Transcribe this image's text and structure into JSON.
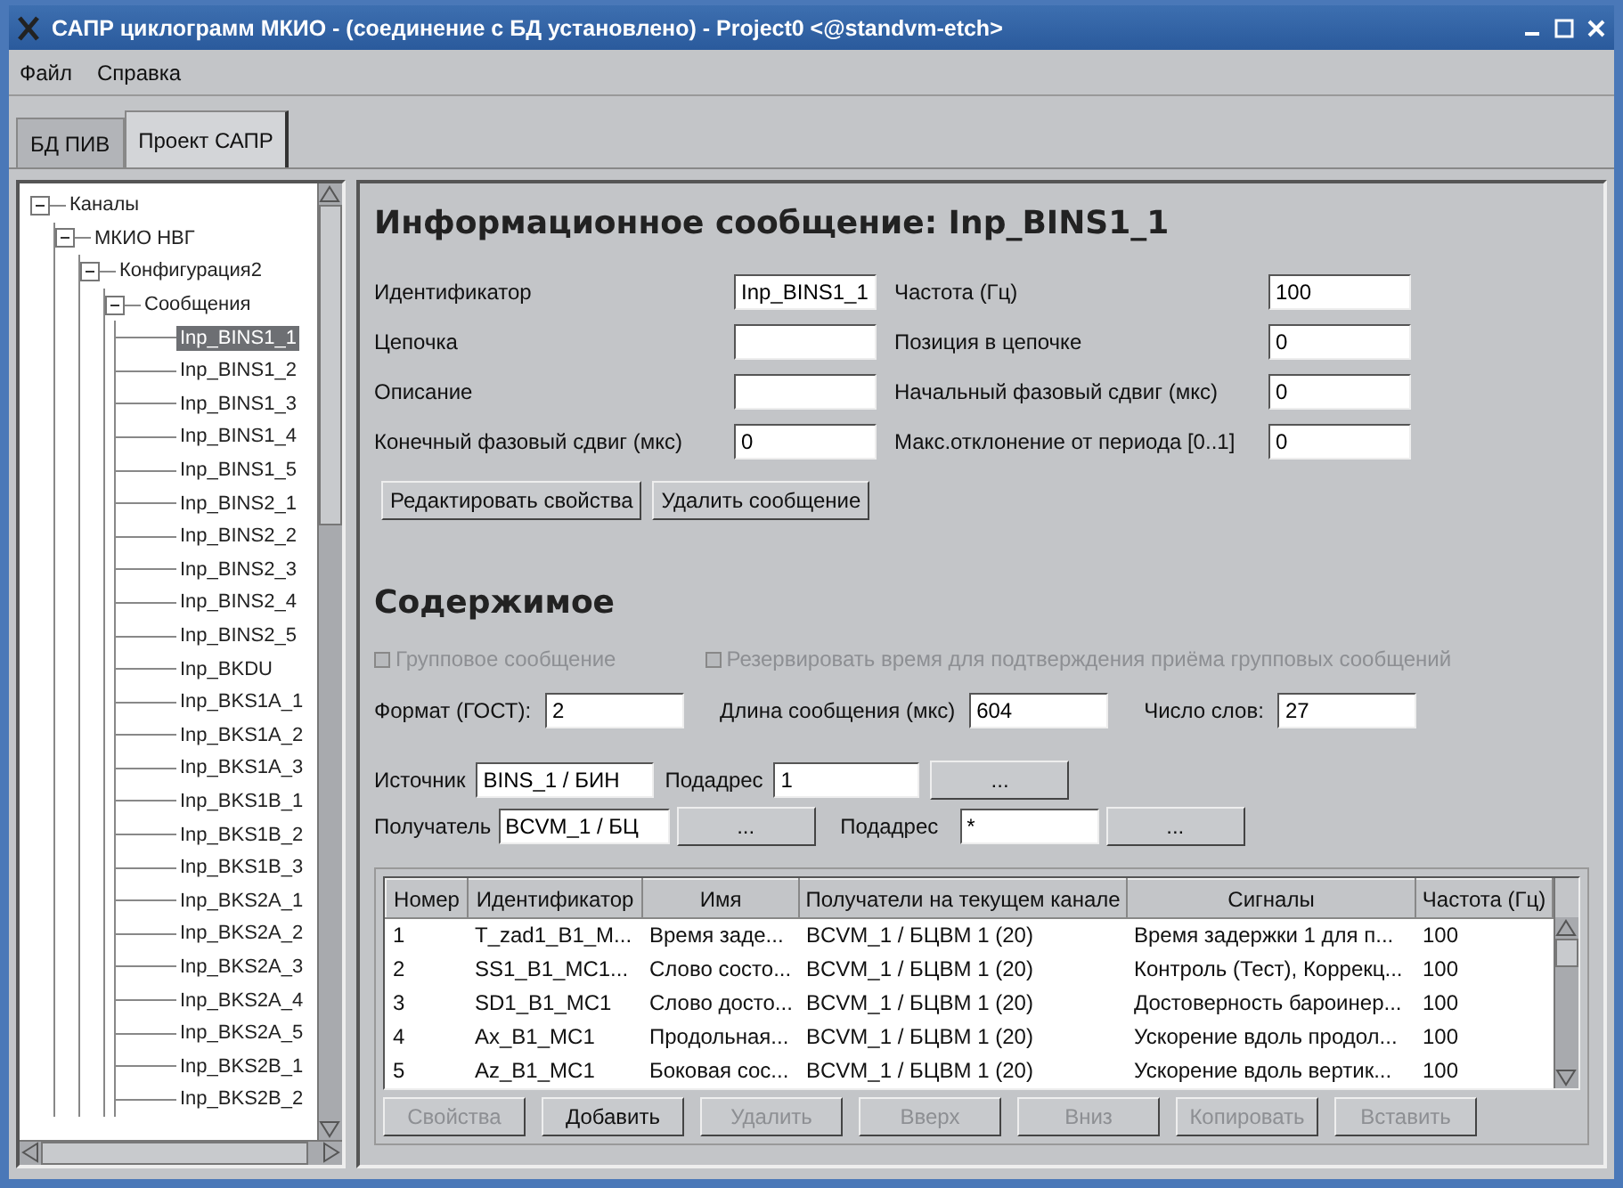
{
  "window": {
    "title": "САПР циклограмм МКИО - (соединение с БД установлено) - Project0 <@standvm-etch>"
  },
  "menu": [
    {
      "label": "Файл"
    },
    {
      "label": "Справка"
    }
  ],
  "tabs": [
    {
      "label": "БД ПИВ",
      "selected": false
    },
    {
      "label": "Проект САПР",
      "selected": true
    }
  ],
  "tree": [
    {
      "label": "Каналы",
      "expanded": true,
      "selected": false,
      "children": [
        {
          "label": "МКИО НВГ",
          "expanded": true,
          "selected": false,
          "children": [
            {
              "label": "Конфигурация2",
              "expanded": true,
              "selected": false,
              "children": [
                {
                  "label": "Сообщения",
                  "expanded": true,
                  "selected": false,
                  "children": [
                    {
                      "label": "Inp_BINS1_1",
                      "selected": true
                    },
                    {
                      "label": "Inp_BINS1_2",
                      "selected": false
                    },
                    {
                      "label": "Inp_BINS1_3",
                      "selected": false
                    },
                    {
                      "label": "Inp_BINS1_4",
                      "selected": false
                    },
                    {
                      "label": "Inp_BINS1_5",
                      "selected": false
                    },
                    {
                      "label": "Inp_BINS2_1",
                      "selected": false
                    },
                    {
                      "label": "Inp_BINS2_2",
                      "selected": false
                    },
                    {
                      "label": "Inp_BINS2_3",
                      "selected": false
                    },
                    {
                      "label": "Inp_BINS2_4",
                      "selected": false
                    },
                    {
                      "label": "Inp_BINS2_5",
                      "selected": false
                    },
                    {
                      "label": "Inp_BKDU",
                      "selected": false
                    },
                    {
                      "label": "Inp_BKS1A_1",
                      "selected": false
                    },
                    {
                      "label": "Inp_BKS1A_2",
                      "selected": false
                    },
                    {
                      "label": "Inp_BKS1A_3",
                      "selected": false
                    },
                    {
                      "label": "Inp_BKS1B_1",
                      "selected": false
                    },
                    {
                      "label": "Inp_BKS1B_2",
                      "selected": false
                    },
                    {
                      "label": "Inp_BKS1B_3",
                      "selected": false
                    },
                    {
                      "label": "Inp_BKS2A_1",
                      "selected": false
                    },
                    {
                      "label": "Inp_BKS2A_2",
                      "selected": false
                    },
                    {
                      "label": "Inp_BKS2A_3",
                      "selected": false
                    },
                    {
                      "label": "Inp_BKS2A_4",
                      "selected": false
                    },
                    {
                      "label": "Inp_BKS2A_5",
                      "selected": false
                    },
                    {
                      "label": "Inp_BKS2B_1",
                      "selected": false
                    },
                    {
                      "label": "Inp_BKS2B_2",
                      "selected": false
                    }
                  ]
                }
              ]
            }
          ]
        }
      ]
    }
  ],
  "message": {
    "heading": "Информационное сообщение: Inp_BINS1_1",
    "fields": [
      {
        "label": "Идентификатор",
        "value": "Inp_BINS1_1"
      },
      {
        "label": "Частота (Гц)",
        "value": "100"
      },
      {
        "label": "Цепочка"
      },
      {
        "label": "Позиция в цепочке",
        "value": "0"
      },
      {
        "label": "Описание"
      },
      {
        "label": "Начальный фазовый сдвиг (мкс)",
        "value": "0"
      },
      {
        "label": "Конечный фазовый сдвиг (мкс)",
        "value": "0"
      },
      {
        "label": "Макс.отклонение от периода [0..1]",
        "value": "0"
      }
    ],
    "buttons": [
      {
        "label": "Редактировать свойства"
      },
      {
        "label": "Удалить сообщение"
      }
    ]
  },
  "content": {
    "heading": "Содержимое",
    "checkboxes": [
      {
        "label": "Групповое сообщение",
        "checked": false,
        "disabled": true
      },
      {
        "label": "Резервировать время для подтверждения приёма групповых сообщений",
        "checked": false,
        "disabled": true
      }
    ],
    "params": [
      {
        "label": "Формат (ГОСТ):",
        "value": "2"
      },
      {
        "label": "Длина сообщения (мкс)",
        "value": "604"
      },
      {
        "label": "Число слов:",
        "value": "27"
      }
    ],
    "source": {
      "label": "Источник",
      "value": "BINS_1 / БИН",
      "sub_label": "Подадрес",
      "sub_value": "1",
      "button": "..."
    },
    "receiver": {
      "label": "Получатель",
      "value": "BCVM_1 / БЦ",
      "button": "...",
      "sub_label": "Подадрес",
      "sub_value": "*",
      "sub_button": "..."
    },
    "table": {
      "columns": [
        "Номер",
        "Идентификатор",
        "Имя",
        "Получатели на текущем канале",
        "Сигналы",
        "Частота (Гц)"
      ],
      "rows": [
        [
          "1",
          "T_zad1_B1_M...",
          "Время заде...",
          "BCVM_1 / БЦВМ 1 (20)",
          "Время задержки 1 для п...",
          "100"
        ],
        [
          "2",
          "SS1_B1_MC1...",
          "Слово состо...",
          "BCVM_1 / БЦВМ 1 (20)",
          "Контроль (Тест), Коррекц...",
          "100"
        ],
        [
          "3",
          "SD1_B1_MC1",
          "Слово досто...",
          "BCVM_1 / БЦВМ 1 (20)",
          "Достоверность бароинер...",
          "100"
        ],
        [
          "4",
          "Ax_B1_MC1",
          "Продольная...",
          "BCVM_1 / БЦВМ 1 (20)",
          "Ускорение вдоль продол...",
          "100"
        ],
        [
          "5",
          "Az_B1_MC1",
          "Боковая сос...",
          "BCVM_1 / БЦВМ 1 (20)",
          "Ускорение вдоль вертик...",
          "100"
        ]
      ]
    },
    "buttons": [
      {
        "label": "Свойства",
        "disabled": true
      },
      {
        "label": "Добавить",
        "disabled": false
      },
      {
        "label": "Удалить",
        "disabled": true
      },
      {
        "label": "Вверх",
        "disabled": true
      },
      {
        "label": "Вниз",
        "disabled": true
      },
      {
        "label": "Копировать",
        "disabled": true
      },
      {
        "label": "Вставить",
        "disabled": true
      }
    ]
  }
}
